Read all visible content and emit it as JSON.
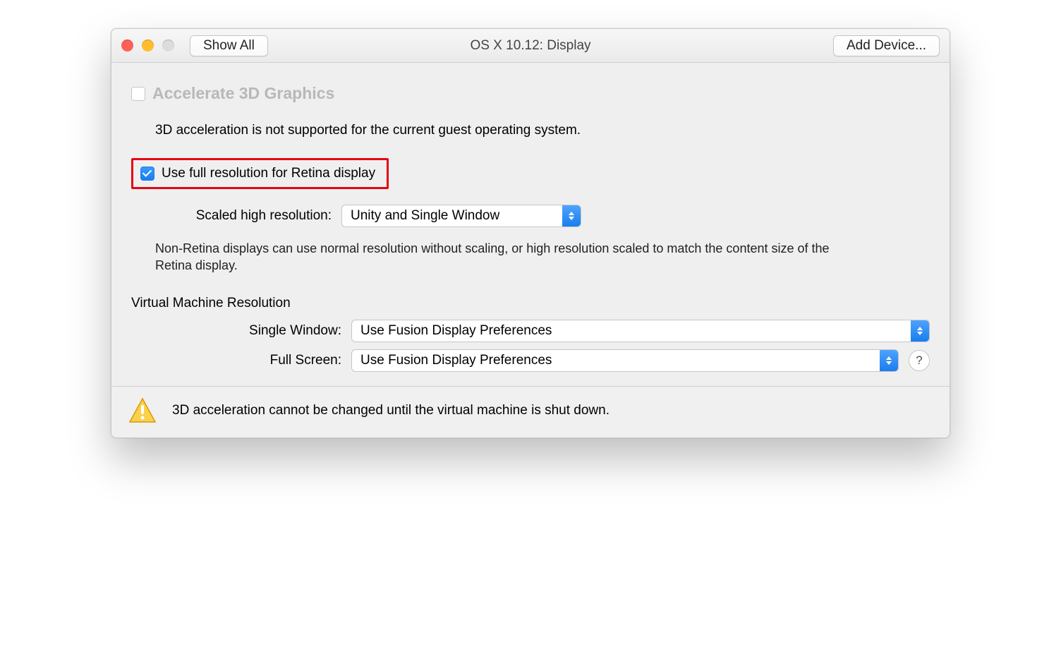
{
  "header": {
    "show_all_label": "Show All",
    "title": "OS X 10.12: Display",
    "add_device_label": "Add Device..."
  },
  "accelerate_3d": {
    "label": "Accelerate 3D Graphics",
    "description": "3D acceleration is not supported for the current guest operating system."
  },
  "retina": {
    "label": "Use full resolution for Retina display"
  },
  "scaled_resolution": {
    "label": "Scaled high resolution:",
    "value": "Unity and Single Window",
    "note": "Non-Retina displays can use normal resolution without scaling, or high resolution scaled to match the content size of the Retina display."
  },
  "vm_resolution": {
    "heading": "Virtual Machine Resolution",
    "single_window_label": "Single Window:",
    "single_window_value": "Use Fusion Display Preferences",
    "full_screen_label": "Full Screen:",
    "full_screen_value": "Use Fusion Display Preferences"
  },
  "help_label": "?",
  "footer_warning": "3D acceleration cannot be changed until the virtual machine is shut down."
}
